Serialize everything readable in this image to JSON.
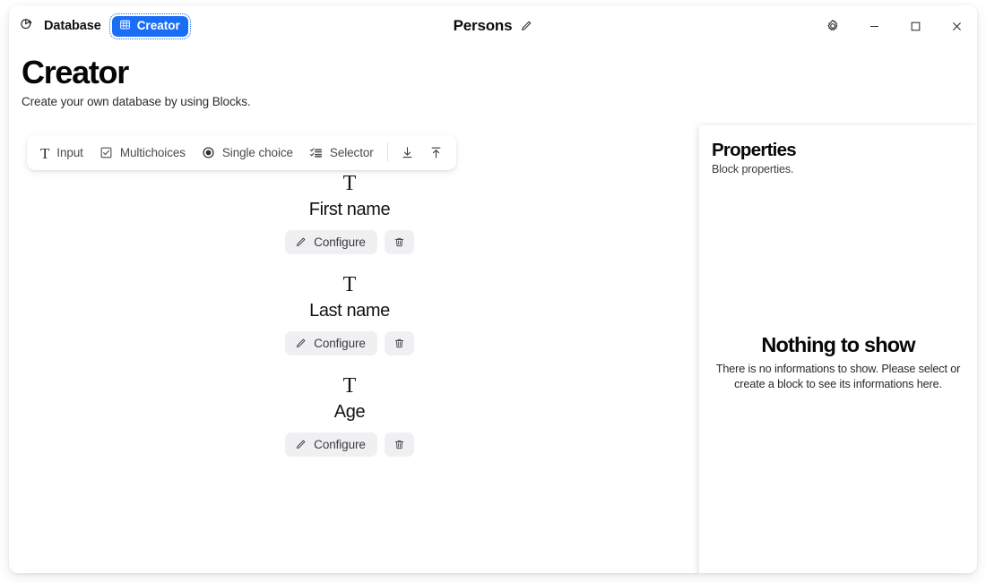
{
  "titlebar": {
    "app_icon": "pie-chart-icon",
    "app_name": "Database",
    "badge_icon": "grid-table-icon",
    "badge_label": "Creator",
    "document_title": "Persons",
    "edit_icon": "pencil-icon",
    "settings_icon": "gear-icon",
    "minimize_icon": "minimize-icon",
    "maximize_icon": "maximize-icon",
    "close_icon": "close-icon",
    "accent_color": "#1a6ef5"
  },
  "header": {
    "title": "Creator",
    "subtitle": "Create your own database by using Blocks."
  },
  "toolbar": {
    "items": [
      {
        "icon": "text-input-icon",
        "glyph": "T",
        "label": "Input"
      },
      {
        "icon": "checkbox-icon",
        "glyph": "",
        "label": "Multichoices"
      },
      {
        "icon": "radio-button-icon",
        "glyph": "",
        "label": "Single choice"
      },
      {
        "icon": "list-check-icon",
        "glyph": "",
        "label": "Selector"
      }
    ],
    "import_icon": "download-icon",
    "export_icon": "upload-icon"
  },
  "blocks": [
    {
      "icon": "text-input-icon",
      "glyph": "T",
      "label": "First name",
      "configure_label": "Configure",
      "configure_icon": "pencil-icon",
      "delete_icon": "trash-icon"
    },
    {
      "icon": "text-input-icon",
      "glyph": "T",
      "label": "Last name",
      "configure_label": "Configure",
      "configure_icon": "pencil-icon",
      "delete_icon": "trash-icon"
    },
    {
      "icon": "text-input-icon",
      "glyph": "T",
      "label": "Age",
      "configure_label": "Configure",
      "configure_icon": "pencil-icon",
      "delete_icon": "trash-icon"
    }
  ],
  "properties": {
    "title": "Properties",
    "subtitle": "Block properties.",
    "empty_title": "Nothing to show",
    "empty_description": "There is no informations to show. Please select or create a block to see its informations here."
  }
}
